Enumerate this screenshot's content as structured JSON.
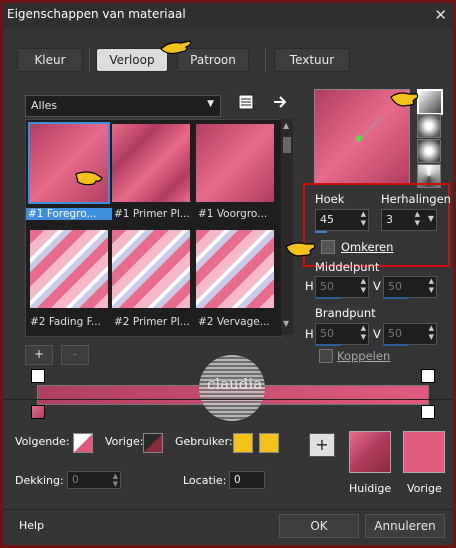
{
  "window": {
    "title": "Eigenschappen van materiaal",
    "close": "✕"
  },
  "tabs": [
    {
      "label": "Kleur"
    },
    {
      "label": "Verloop"
    },
    {
      "label": "Patroon"
    },
    {
      "label": "Textuur"
    }
  ],
  "gallery": {
    "filter": "Alles",
    "items": [
      {
        "label": "#1 Foregro..."
      },
      {
        "label": "#1 Primer Pl..."
      },
      {
        "label": "#1 Voorgro..."
      },
      {
        "label": "#2 Fading F..."
      },
      {
        "label": "#2 Primer Pl..."
      },
      {
        "label": "#2 Vervage..."
      }
    ],
    "add_button": "+",
    "remove_button": "-"
  },
  "gradient_settings": {
    "angle_label": "Hoek",
    "angle_value": "45",
    "repeats_label": "Herhalingen",
    "repeats_value": "3",
    "invert_label": "Omkeren",
    "midpoint_label": "Middelpunt",
    "focal_label": "Brandpunt",
    "h_label": "H",
    "v_label": "V",
    "mid_h": "50",
    "mid_v": "50",
    "focal_h": "50",
    "focal_v": "50",
    "link_label": "Koppelen"
  },
  "gradient_editor": {
    "next_label": "Volgende:",
    "prev_label": "Vorige:",
    "user_label": "Gebruiker:",
    "opacity_label": "Dekking:",
    "opacity_value": "0",
    "location_label": "Locatie:",
    "location_value": "0"
  },
  "bottom": {
    "current_label": "Huidige",
    "previous_label": "Vorige",
    "add_button": "+",
    "help": "Help",
    "ok": "OK",
    "cancel": "Annuleren"
  },
  "watermark": {
    "text": "claudia"
  },
  "colors": {
    "pink_dark": "#b03d5e",
    "pink_mid": "#d45a7c",
    "pink_light": "#e86a8c",
    "accent_blue": "#3d7ed8",
    "red_highlight": "#d01010",
    "selection_border": "#3f8fe0",
    "yellow": "#f2c21a"
  }
}
